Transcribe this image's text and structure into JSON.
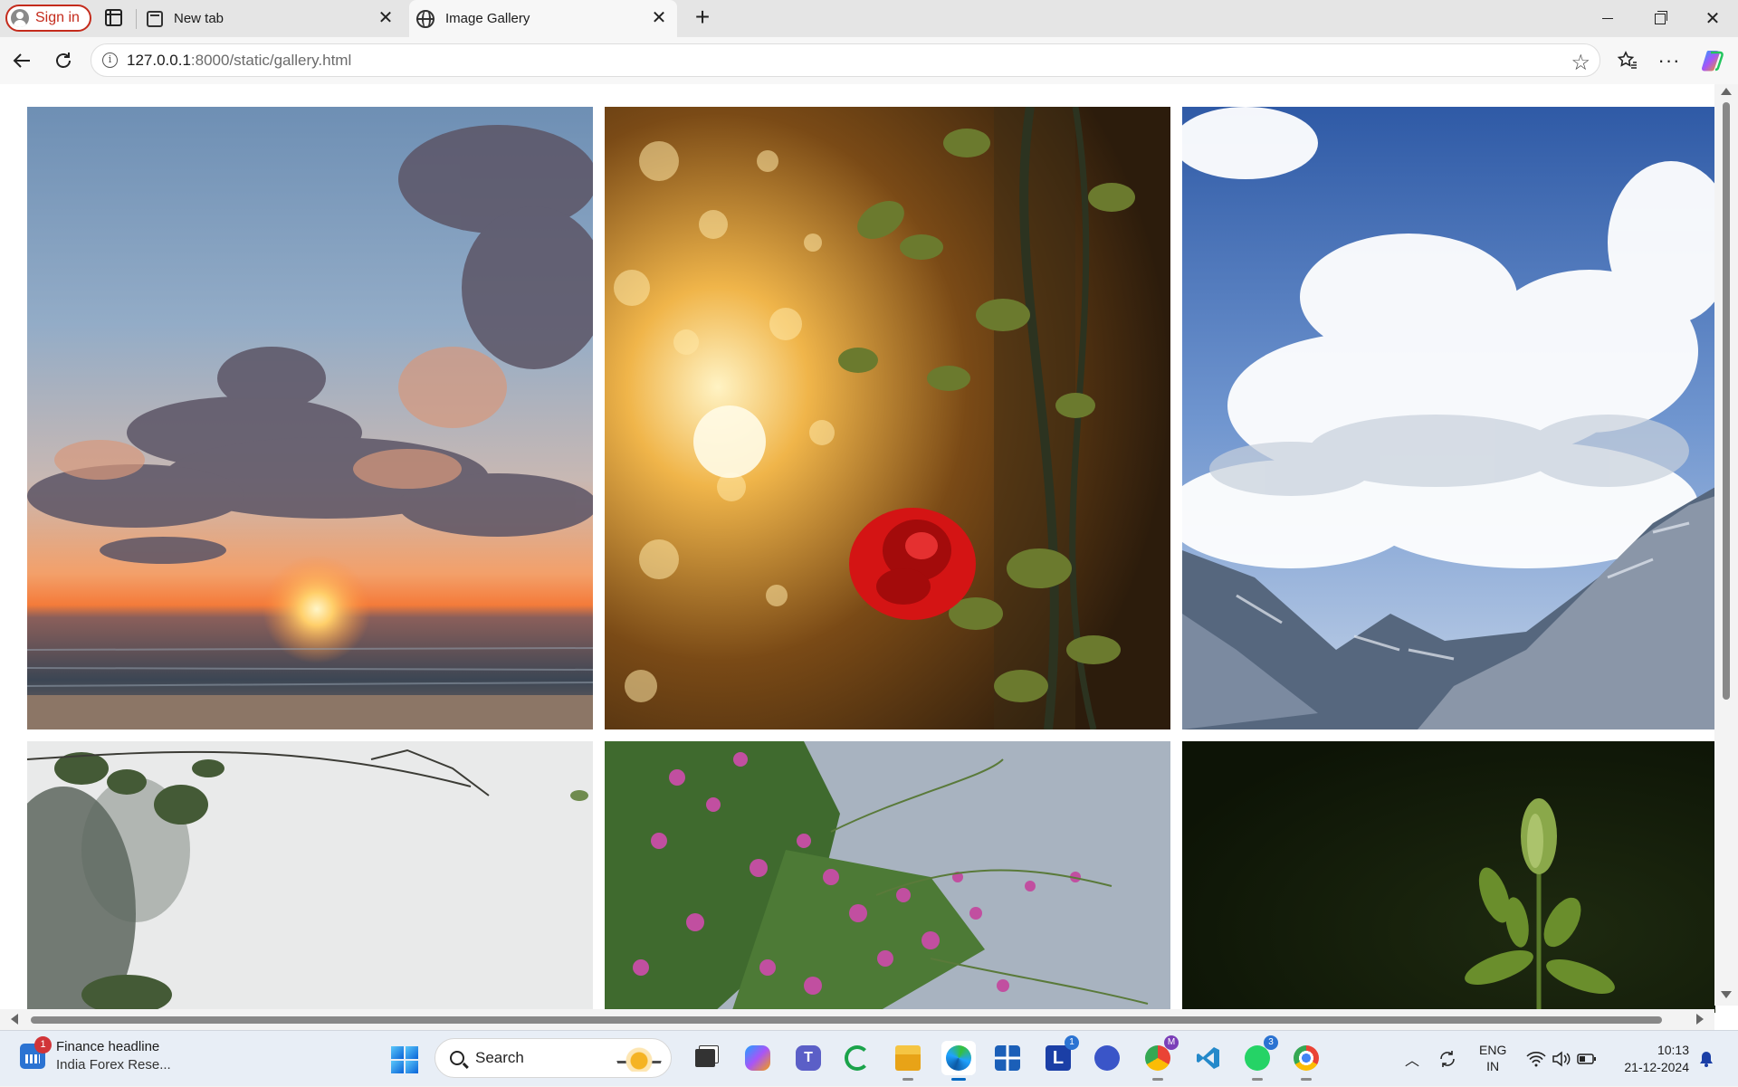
{
  "browser": {
    "signin_label": "Sign in",
    "tabs": [
      {
        "title": "New tab",
        "active": false
      },
      {
        "title": "Image Gallery",
        "active": true
      }
    ],
    "url_host": "127.0.0.1",
    "url_path": ":8000/static/gallery.html"
  },
  "gallery": {
    "images": [
      {
        "subject": "sunset over sea with clouds"
      },
      {
        "subject": "red rose with bokeh sunlight"
      },
      {
        "subject": "clouds over mountain valley"
      },
      {
        "subject": "blurred leaves and branches on bright sky"
      },
      {
        "subject": "pink bougainvillea flowers"
      },
      {
        "subject": "green flower bud on dark background"
      }
    ]
  },
  "taskbar": {
    "news_badge": "1",
    "news_headline": "Finance headline",
    "news_subtext": "India Forex Rese...",
    "search_label": "Search",
    "app_badges": {
      "lens": "1",
      "messenger": "M",
      "whatsapp": "3"
    },
    "lang_line1": "ENG",
    "lang_line2": "IN",
    "time": "10:13",
    "date": "21-12-2024"
  },
  "colors": {
    "signin_accent": "#c42b1c",
    "taskbar_bg": "#e8eef6",
    "active_indicator": "#0067c0"
  }
}
